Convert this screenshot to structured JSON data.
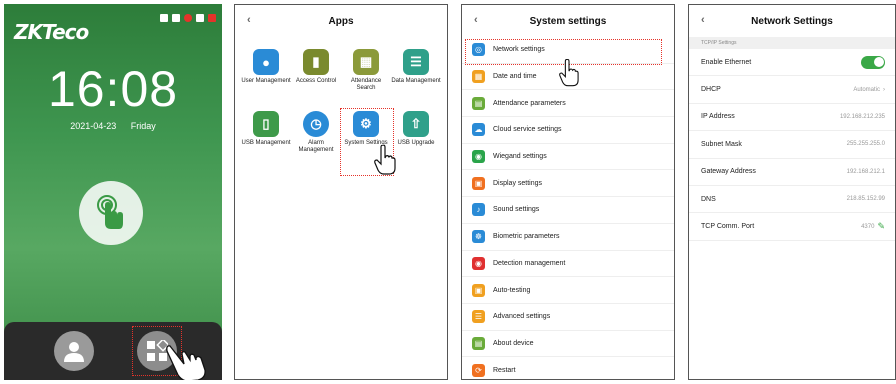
{
  "home": {
    "brand": "ZKTeco",
    "time": "16:08",
    "date": "2021-04-23",
    "weekday": "Friday"
  },
  "apps": {
    "title": "Apps",
    "items": [
      {
        "label": "User Management",
        "color": "#2a8bd6",
        "icon": "user-management-icon"
      },
      {
        "label": "Access Control",
        "color": "#7a8a2e",
        "icon": "access-control-icon"
      },
      {
        "label": "Attendance Search",
        "color": "#8b9a3a",
        "icon": "attendance-search-icon"
      },
      {
        "label": "Data Management",
        "color": "#2fa08a",
        "icon": "data-management-icon"
      },
      {
        "label": "USB Management",
        "color": "#3e9a4a",
        "icon": "usb-management-icon"
      },
      {
        "label": "Alarm Management",
        "color": "#2a8bd6",
        "icon": "alarm-icon"
      },
      {
        "label": "System Settings",
        "color": "#2a8bd6",
        "icon": "system-settings-icon"
      },
      {
        "label": "USB Upgrade",
        "color": "#2fa08a",
        "icon": "usb-upgrade-icon"
      }
    ]
  },
  "system": {
    "title": "System settings",
    "items": [
      {
        "label": "Network settings",
        "color": "#2a8bd6"
      },
      {
        "label": "Date and time",
        "color": "#f0a020"
      },
      {
        "label": "Attendance parameters",
        "color": "#6aab3a"
      },
      {
        "label": "Cloud service settings",
        "color": "#2a8bd6"
      },
      {
        "label": "Wiegand settings",
        "color": "#2aa44a"
      },
      {
        "label": "Display settings",
        "color": "#f07020"
      },
      {
        "label": "Sound settings",
        "color": "#2a8bd6"
      },
      {
        "label": "Biometric parameters",
        "color": "#2a8bd6"
      },
      {
        "label": "Detection management",
        "color": "#e03030"
      },
      {
        "label": "Auto-testing",
        "color": "#f0a020"
      },
      {
        "label": "Advanced settings",
        "color": "#f0a020"
      },
      {
        "label": "About device",
        "color": "#6aab3a"
      },
      {
        "label": "Restart",
        "color": "#f07020"
      }
    ]
  },
  "network": {
    "title": "Network Settings",
    "section": "TCP/IP Settings",
    "rows": [
      {
        "label": "Enable Ethernet",
        "value": ""
      },
      {
        "label": "DHCP",
        "value": "Automatic"
      },
      {
        "label": "IP Address",
        "value": "192.168.212.235"
      },
      {
        "label": "Subnet Mask",
        "value": "255.255.255.0"
      },
      {
        "label": "Gateway Address",
        "value": "192.168.212.1"
      },
      {
        "label": "DNS",
        "value": "218.85.152.99"
      },
      {
        "label": "TCP Comm. Port",
        "value": "4370"
      }
    ]
  }
}
